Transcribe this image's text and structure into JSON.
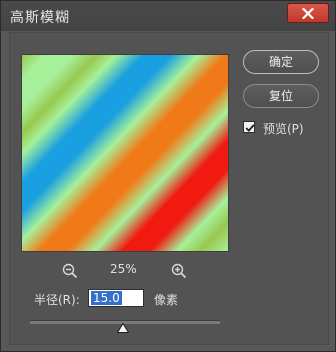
{
  "window": {
    "title": "高斯模糊"
  },
  "buttons": {
    "ok_label": "确定",
    "reset_label": "复位"
  },
  "preview": {
    "checkbox_label": "预览(P)",
    "checked": true,
    "stripe_colors": [
      "#a6f09a",
      "#98c850",
      "#1aa0e0",
      "#f07a18",
      "#f01a10"
    ]
  },
  "zoom": {
    "level": "25%",
    "zoom_out_icon": "zoom-out-icon",
    "zoom_in_icon": "zoom-in-icon"
  },
  "radius": {
    "label": "半径(R):",
    "value": "15.0",
    "unit": "像素",
    "slider_fraction": 0.49
  },
  "colors": {
    "close_button": "#c1392b",
    "selection": "#3470c8"
  }
}
